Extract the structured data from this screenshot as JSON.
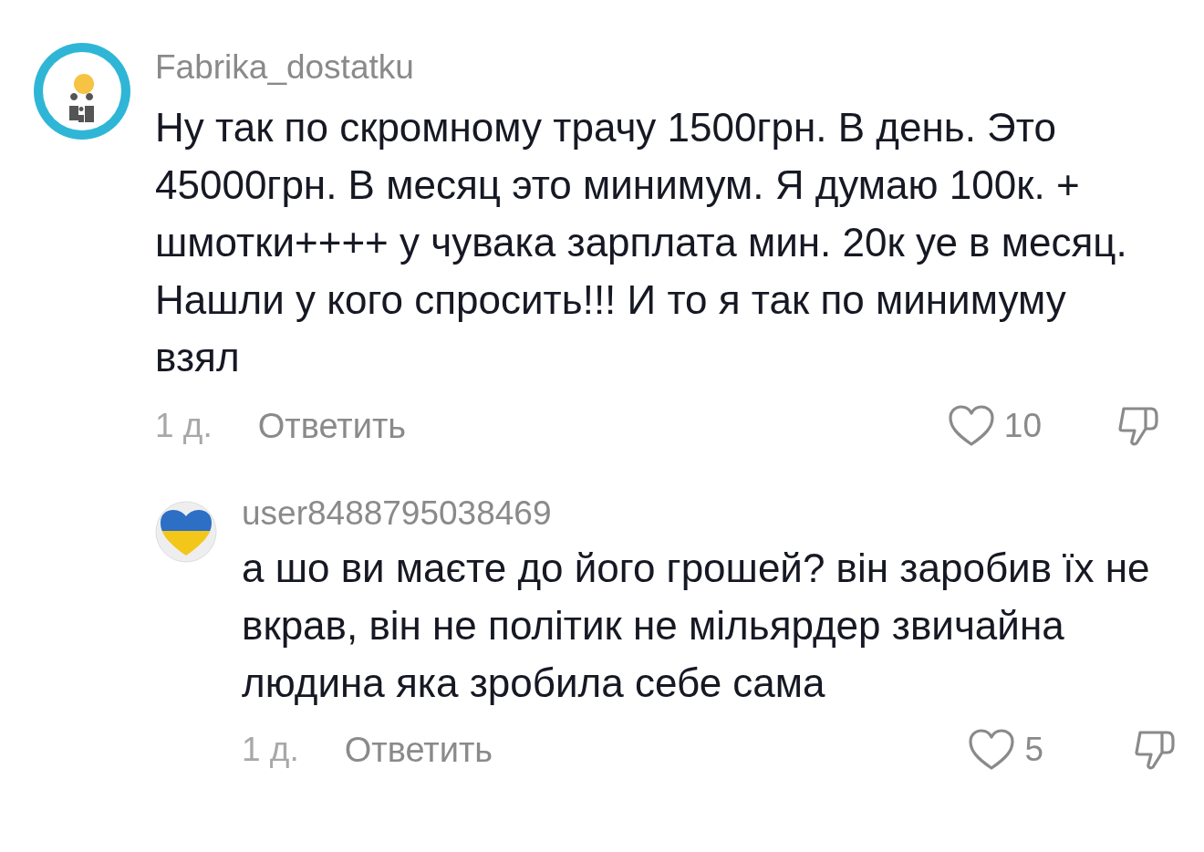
{
  "comments": [
    {
      "avatar": {
        "kind": "logo"
      },
      "username": "Fabrika_dostatku",
      "text": "Ну так по скромному трачу 1500грн. В день. Это 45000грн. В месяц это минимум. Я думаю 100к. + шмотки++++ у чувака зарплата мин. 20к уе в месяц. Нашли у кого спросить!!! И то я так по минимуму взял",
      "time": "1 д.",
      "reply_label": "Ответить",
      "likes": "10",
      "replies": [
        {
          "avatar": {
            "kind": "flag-heart"
          },
          "username": "user8488795038469",
          "text": "а шо ви маєте до його грошей? він заробив їх не вкрав, він не політик не мільярдер звичайна людина яка зробила себе сама",
          "time": "1 д.",
          "reply_label": "Ответить",
          "likes": "5"
        }
      ]
    }
  ]
}
